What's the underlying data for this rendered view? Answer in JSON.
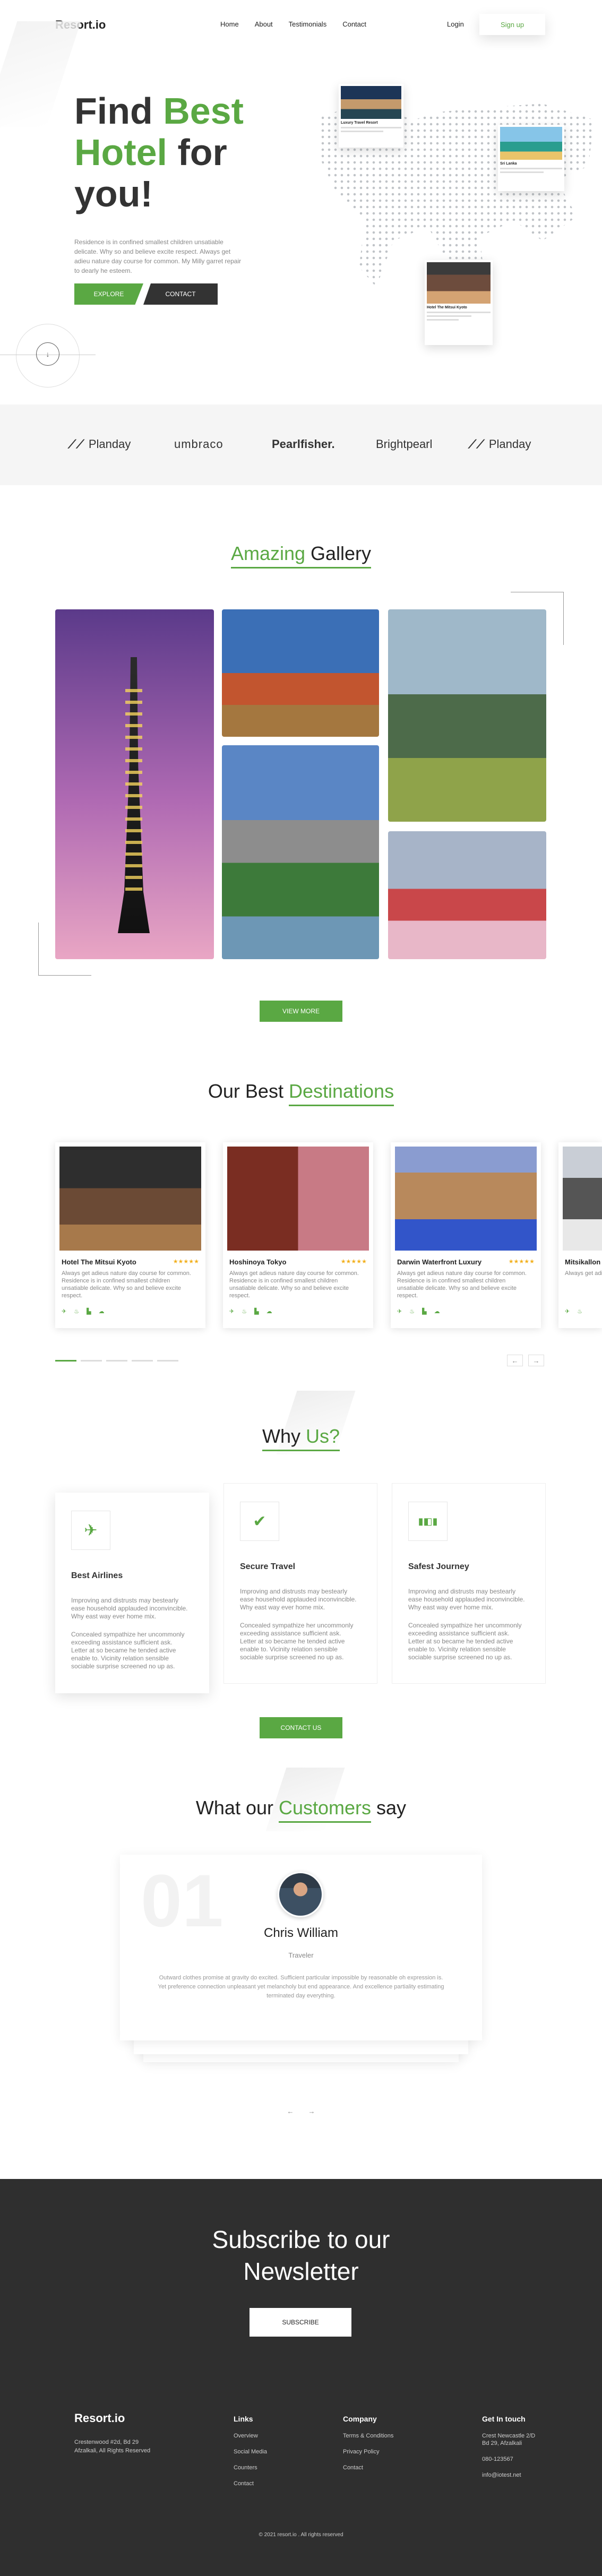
{
  "header": {
    "logo": "Resort.io",
    "menu": [
      "Home",
      "About",
      "Testimonials",
      "Contact"
    ],
    "login": "Login",
    "signup": "Sign up"
  },
  "hero": {
    "title_part1": "Find ",
    "title_best": "Best",
    "title_hotel": "Hotel",
    "title_part2": " for",
    "title_part3": "you!",
    "text": "Residence is in confined smallest children unsatiable delicate. Why so and believe excite respect. Always get adieu nature day course for common. My Milly garret repair to dearly he esteem.",
    "explore": "EXPLORE",
    "contact": "CONTACT",
    "card1_title": "Luxury Travel Resort",
    "card2_title": "Sri Lanka",
    "card3_title": "Hotel The Mitsui Kyoto"
  },
  "partners": [
    "Planday",
    "umbraco",
    "Pearlfisher.",
    "Brightpearl",
    "Planday"
  ],
  "gallery": {
    "title_green": "Amazing",
    "title_rest": " Gallery",
    "view_more": "VIEW MORE"
  },
  "destinations": {
    "title_dark": "Our Best ",
    "title_green": "Destinations",
    "cards": [
      {
        "name": "Hotel The Mitsui Kyoto",
        "stars": "★★★★★",
        "desc": "Always get adieus nature day course for common. Residence is in confined smallest children unsatiable delicate. Why so and believe excite respect."
      },
      {
        "name": "Hoshinoya Tokyo",
        "stars": "★★★★★",
        "desc": "Always get adieus nature day course for common. Residence is in confined smallest children unsatiable delicate. Why so and believe excite respect."
      },
      {
        "name": "Darwin Waterfront Luxury",
        "stars": "★★★★★",
        "desc": "Always get adieus nature day course for common. Residence is in confined smallest children unsatiable delicate. Why so and believe excite respect."
      },
      {
        "name": "Mitsikallon",
        "stars": "",
        "desc": "Always get adieus children unsatiable believe excite"
      }
    ],
    "icons": [
      "✈",
      "♨",
      "▙",
      "☁"
    ]
  },
  "why": {
    "title_dark": "Why ",
    "title_green": "Us?",
    "cards": [
      {
        "icon": "✈",
        "title": "Best Airlines",
        "desc": "Improving and distrusts may bestearly ease household applauded inconvincible. Why east way ever home mix.",
        "desc2": "Concealed sympathize her uncommonly exceeding assistance sufficient ask. Letter at so became he tended active enable to. Vicinity relation sensible sociable surprise screened no up as."
      },
      {
        "icon": "✔",
        "title": "Secure Travel",
        "desc": "Improving and distrusts may bestearly ease household applauded inconvincible. Why east way ever home mix.",
        "desc2": "Concealed sympathize her uncommonly exceeding assistance sufficient ask. Letter at so became he tended active enable to. Vicinity relation sensible sociable surprise screened no up as."
      },
      {
        "icon": "▮◧▮",
        "title": "Safest Journey",
        "desc": "Improving and distrusts may bestearly ease household applauded inconvincible. Why east way ever home mix.",
        "desc2": "Concealed sympathize her uncommonly exceeding assistance sufficient ask. Letter at so became he tended active enable to. Vicinity relation sensible sociable surprise screened no up as."
      }
    ],
    "contact_us": "CONTACT US"
  },
  "testimonials": {
    "title_dark1": "What our ",
    "title_green": "Customers",
    "title_dark2": " say",
    "number": "01",
    "name": "Chris William",
    "role": "Traveler",
    "quote": "Outward clothes promise at gravity do excited. Sufficient particular impossible by reasonable oh expression is. Yet preference connection unpleasant yet melancholy but end appearance. And excellence partiality estimating terminated day everything."
  },
  "newsletter": {
    "title_line1": "Subscribe to our",
    "title_line2": "Newsletter",
    "button": "SUBSCRIBE"
  },
  "footer": {
    "logo": "Resort.io",
    "address1": "Crestenwood #2d, Bd 29",
    "address2": "Afzalkali, All Rights Reserved",
    "links_title": "Links",
    "links": [
      "Overview",
      "Social Media",
      "Counters",
      "Contact"
    ],
    "company_title": "Company",
    "company": [
      "Terms & Conditions",
      "Privacy Policy",
      "Contact"
    ],
    "touch_title": "Get In touch",
    "touch": [
      "Crest Newcastle 2/D",
      "Bd 29, Afzalkali",
      "080-123567",
      "info@iotest.net"
    ],
    "copyright": "© 2021 resort.io . All rights reserved"
  },
  "colors": {
    "accent": "#5aa843",
    "dark": "#2f2f2f",
    "star": "#f2b01e"
  }
}
